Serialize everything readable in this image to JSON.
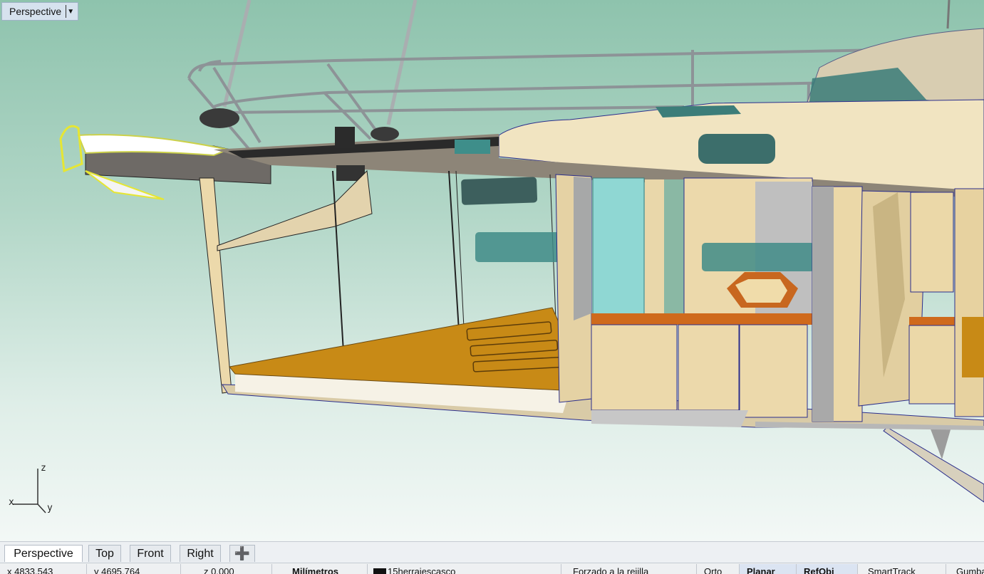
{
  "viewport": {
    "title": "Perspective",
    "menu_icon": "triangle-down-icon",
    "axes": {
      "z": "z",
      "x": "x",
      "y": "y"
    }
  },
  "tabs": [
    {
      "label": "Perspective",
      "active": true
    },
    {
      "label": "Top",
      "active": false
    },
    {
      "label": "Front",
      "active": false
    },
    {
      "label": "Right",
      "active": false
    }
  ],
  "add_tab_icon": "plus-icon",
  "status": {
    "x": "x 4833.543",
    "y": "y 4695.764",
    "z": "z 0.000",
    "units": "Milímetros",
    "layer": "15herrajescasco",
    "snap": "Forzado a la rejilla",
    "ortho": "Orto",
    "planar": "Planar",
    "osnap": "RefObj",
    "smarttrack": "SmartTrack",
    "gumball": "Gumball"
  },
  "colors": {
    "viewport_top": "#8ec3ad",
    "viewport_bottom": "#f3f8f6",
    "teak": "#c88a16",
    "wood": "#ecd9ab",
    "glass": "#3f8b87",
    "edge": "#2b2e8c"
  }
}
